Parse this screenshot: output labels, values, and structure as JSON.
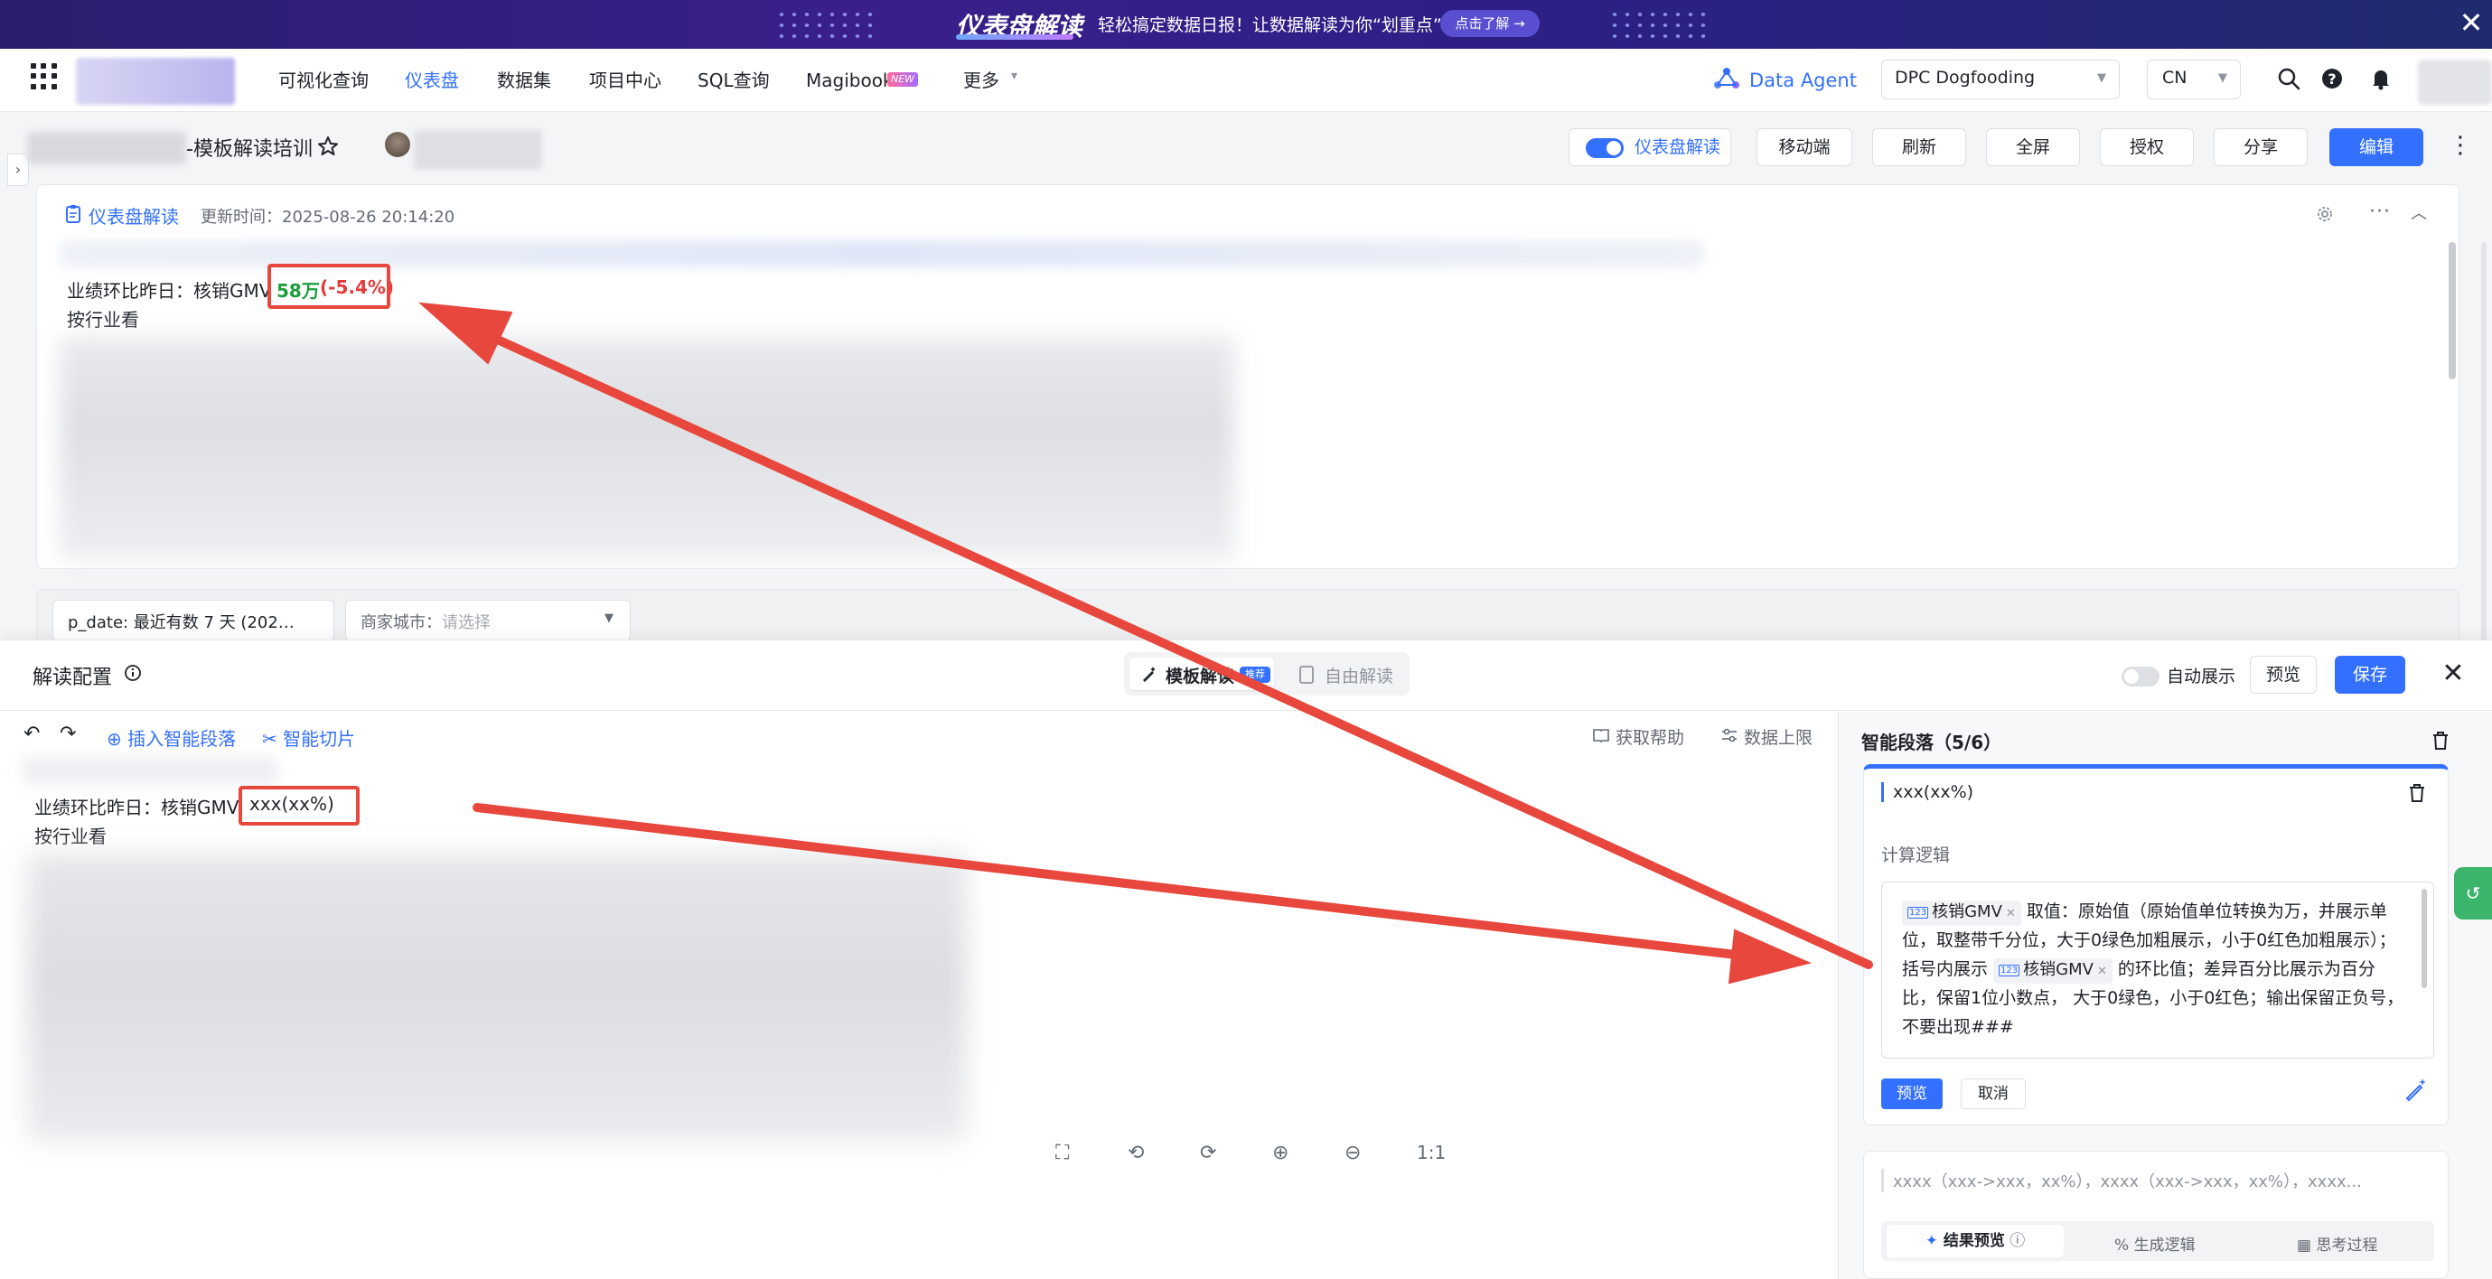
{
  "banner": {
    "title": "仪表盘解读",
    "text": "轻松搞定数据日报！让数据解读为你“划重点”",
    "button": "点击了解 →",
    "close": "✕"
  },
  "nav": {
    "items": [
      "可视化查询",
      "仪表盘",
      "数据集",
      "项目中心",
      "SQL查询",
      "Magibook",
      "更多"
    ],
    "new_badge": "NEW",
    "more_caret": "▾",
    "data_agent": "Data Agent",
    "workspace": "DPC Dogfooding",
    "language": "CN"
  },
  "dashboard": {
    "title": "-模板解读培训",
    "left_toggle": "›",
    "buttons": {
      "interpret": "仪表盘解读",
      "mobile": "移动端",
      "refresh": "刷新",
      "fullscreen": "全屏",
      "authorize": "授权",
      "share": "分享",
      "edit": "编辑",
      "more": "⋮"
    }
  },
  "interpretation": {
    "label": "仪表盘解读",
    "updated": "更新时间：2025-08-26 20:14:20",
    "more": "···",
    "collapse": "︿",
    "line_prefix": "业绩环比昨日：核销GMV",
    "value": "58万",
    "change": "(-5.4%)",
    "industry": "按行业看"
  },
  "filters": {
    "date": "p_date: 最近有数 7 天 (202…",
    "city_label": "商家城市：",
    "city_placeholder": "请选择"
  },
  "drawer": {
    "title": "解读配置",
    "tab_template": "模板解读",
    "tab_badge": "推荐",
    "tab_free": "自由解读",
    "auto_show": "自动展示",
    "preview": "预览",
    "save": "保存",
    "close": "✕",
    "toolbar": {
      "undo": "↶",
      "redo": "↷",
      "insert": "⊕ 插入智能段落",
      "slice": "✂ 智能切片",
      "help": "获取帮助",
      "limit": "数据上限"
    },
    "editor": {
      "line_prefix": "业绩环比昨日：核销GMV",
      "placeholder": "xxx(xx%)",
      "industry": "按行业看"
    },
    "canvas_tools": [
      "⛶",
      "⟲",
      "⟳",
      "⊕",
      "⊖",
      "1:1"
    ]
  },
  "smart_panel": {
    "title": "智能段落（5/6）",
    "segment_name": "xxx(xx%)",
    "calc_label": "计算逻辑",
    "metric": "核销GMV",
    "metric_tag": "123",
    "logic_part1": "取值：原始值（原始值单位转换为万，并展示单位，取整带千分位，大于0绿色加粗展示，小于0红色加粗展示）；",
    "logic_part2": "括号内展示",
    "logic_part3": "的环比值；差异百分比展示为百分比，保留1位小数点， 大于0绿色，小于0红色；输出保留正负号，不要出现###",
    "btn_preview": "预览",
    "btn_cancel": "取消",
    "result_text": "xxxx（xxx->xxx，xx%），xxxx（xxx->xxx，xx%），xxxx...",
    "tab_result": "结果预览",
    "tab_logic": "生成逻辑",
    "tab_think": "思考过程",
    "float": "↺"
  },
  "colors": {
    "accent": "#3370ff",
    "positive": "#1a9e3c",
    "negative": "#e23b3b",
    "annotation": "#e7473c"
  }
}
